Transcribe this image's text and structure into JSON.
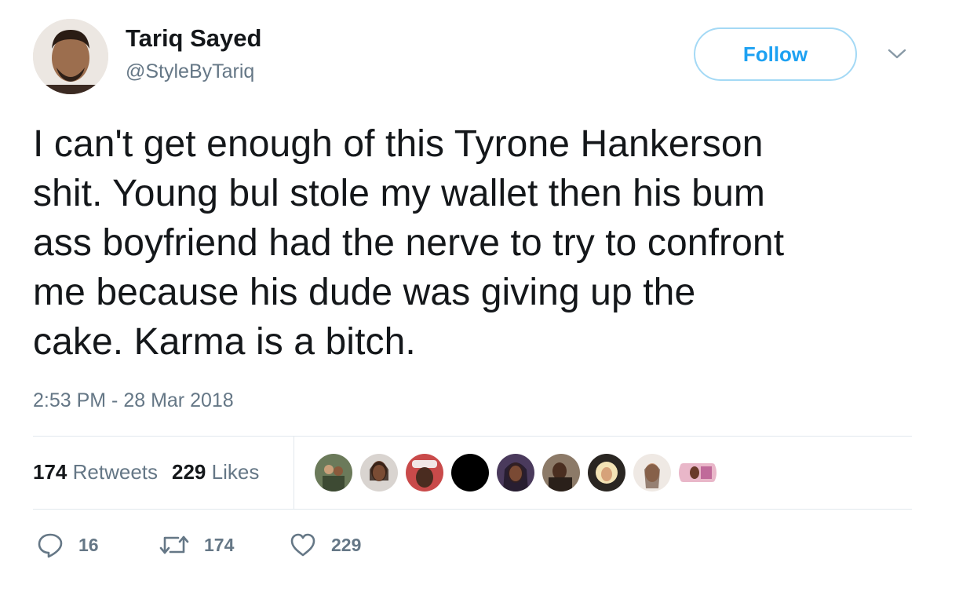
{
  "user": {
    "name": "Tariq Sayed",
    "handle": "@StyleByTariq"
  },
  "follow_label": "Follow",
  "tweet": {
    "lines": [
      "I can't get enough of this Tyrone Hankerson",
      "shit. Young bul stole my wallet then his bum",
      "ass boyfriend had the nerve to try to confront",
      "me because his dude was giving up the",
      "cake. Karma is a bitch."
    ],
    "timestamp": "2:53 PM - 28 Mar 2018"
  },
  "stats": {
    "retweets_count": "174",
    "retweets_label": "Retweets",
    "likes_count": "229",
    "likes_label": "Likes"
  },
  "actions": {
    "reply_count": "16",
    "retweet_count": "174",
    "like_count": "229"
  },
  "colors": {
    "accent": "#1da1f2",
    "secondary_text": "#657786",
    "divider": "#e1e8ed"
  }
}
